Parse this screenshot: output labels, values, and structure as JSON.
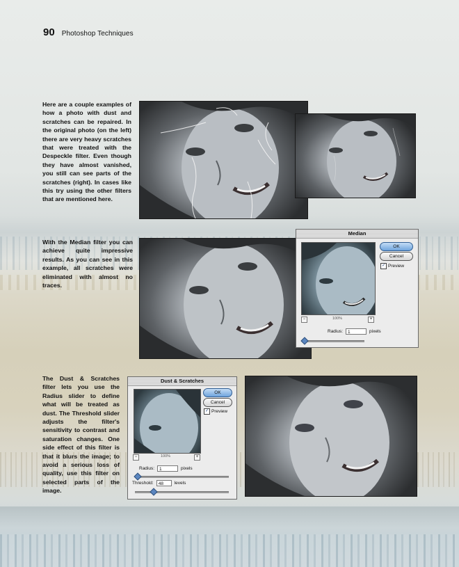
{
  "header": {
    "page_number": "90",
    "running_title": "Photoshop Techniques"
  },
  "paragraphs": {
    "p1": "Here are a couple examples of how a photo with dust and scratches can be repaired. In the original photo (on the left) there are very heavy scratches that were treated with the Despeckle filter. Even though they have almost vanished, you still can see parts of the scratches (right). In cases like this try using the other filters that are mentioned here.",
    "p2": "With the Median filter you can achieve quite impressive results. As you can see in this example, all scratches were eliminated with almost no traces.",
    "p3": "The Dust & Scratches filter lets you use the Radius slider to define what will be treated as dust. The Threshold slider adjusts the filter's sensitivity to contrast and saturation changes. One side effect of this filter is that it blurs the image; to avoid a serious loss of quality, use this filter on selected parts of the image."
  },
  "median_dialog": {
    "title": "Median",
    "ok_label": "OK",
    "cancel_label": "Cancel",
    "preview_label": "Preview",
    "preview_checked": true,
    "zoom_minus": "−",
    "zoom_plus": "+",
    "zoom_value": "100%",
    "radius_label": "Radius:",
    "radius_value": "1",
    "radius_unit": "pixels",
    "radius_slider_fraction": 0.02
  },
  "dust_dialog": {
    "title": "Dust & Scratches",
    "ok_label": "OK",
    "cancel_label": "Cancel",
    "preview_label": "Preview",
    "preview_checked": true,
    "zoom_minus": "−",
    "zoom_plus": "+",
    "zoom_value": "100%",
    "radius_label": "Radius:",
    "radius_value": "1",
    "radius_unit": "pixels",
    "radius_slider_fraction": 0.02,
    "threshold_label": "Threshold:",
    "threshold_value": "48",
    "threshold_unit": "levels",
    "threshold_slider_fraction": 0.19
  },
  "checkmark": "✓"
}
